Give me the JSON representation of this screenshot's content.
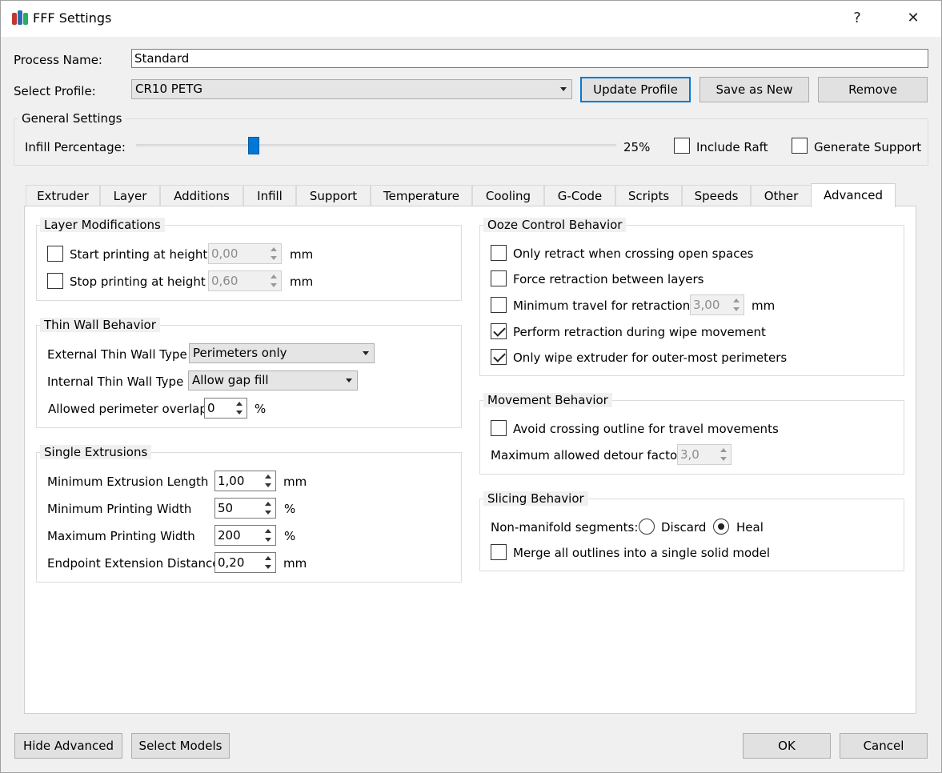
{
  "window": {
    "title": "FFF Settings",
    "help": "?",
    "close": "✕"
  },
  "process": {
    "label": "Process Name:",
    "value": "Standard"
  },
  "profile": {
    "label": "Select Profile:",
    "value": "CR10 PETG",
    "update": "Update Profile",
    "save_new": "Save as New",
    "remove": "Remove"
  },
  "general": {
    "title": "General Settings",
    "infill_label": "Infill Percentage:",
    "infill_percent": 25,
    "infill_value": "25%",
    "raft": "Include Raft",
    "support": "Generate Support"
  },
  "tabs": [
    "Extruder",
    "Layer",
    "Additions",
    "Infill",
    "Support",
    "Temperature",
    "Cooling",
    "G-Code",
    "Scripts",
    "Speeds",
    "Other",
    "Advanced"
  ],
  "active_tab": "Advanced",
  "layer_mod": {
    "title": "Layer Modifications",
    "start_label": "Start printing at height",
    "start_value": "0,00",
    "start_unit": "mm",
    "stop_label": "Stop printing at height",
    "stop_value": "0,60",
    "stop_unit": "mm"
  },
  "thin_wall": {
    "title": "Thin Wall Behavior",
    "external_label": "External Thin Wall Type",
    "external_value": "Perimeters only",
    "internal_label": "Internal Thin Wall Type",
    "internal_value": "Allow gap fill",
    "overlap_label": "Allowed perimeter overlap",
    "overlap_value": "0",
    "overlap_unit": "%"
  },
  "single": {
    "title": "Single Extrusions",
    "rows": [
      {
        "label": "Minimum Extrusion Length",
        "value": "1,00",
        "unit": "mm"
      },
      {
        "label": "Minimum Printing Width",
        "value": "50",
        "unit": "%"
      },
      {
        "label": "Maximum Printing Width",
        "value": "200",
        "unit": "%"
      },
      {
        "label": "Endpoint Extension Distance",
        "value": "0,20",
        "unit": "mm"
      }
    ]
  },
  "ooze": {
    "title": "Ooze Control Behavior",
    "only_retract": "Only retract when crossing open spaces",
    "force_retract": "Force retraction between layers",
    "min_travel": "Minimum travel for retraction",
    "min_travel_value": "3,00",
    "min_travel_unit": "mm",
    "perform_wipe": "Perform retraction during wipe movement",
    "only_wipe": "Only wipe extruder for outer-most perimeters"
  },
  "movement": {
    "title": "Movement Behavior",
    "avoid": "Avoid crossing outline for travel movements",
    "detour_label": "Maximum allowed detour factor",
    "detour_value": "3,0"
  },
  "slicing": {
    "title": "Slicing Behavior",
    "nonmanifold_label": "Non-manifold segments:",
    "discard": "Discard",
    "heal": "Heal",
    "merge": "Merge all outlines into a single solid model"
  },
  "footer": {
    "hide_advanced": "Hide Advanced",
    "select_models": "Select Models",
    "ok": "OK",
    "cancel": "Cancel"
  },
  "colors": {
    "accent": "#0078d7",
    "logo": [
      "#c0392b",
      "#27ae60",
      "#2b6cb0"
    ]
  }
}
